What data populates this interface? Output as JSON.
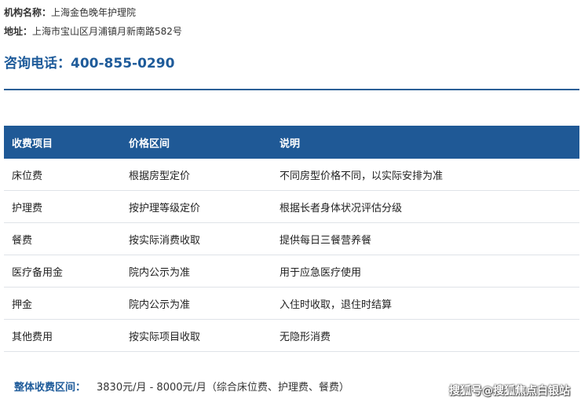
{
  "institution": {
    "name_label": "机构名称：",
    "name": "上海金色晚年护理院",
    "address_label": "地址：",
    "address": "上海市宝山区月浦镇月新南路582号"
  },
  "contact": {
    "phone_label": "咨询电话：",
    "phone": "400-855-0290"
  },
  "fee_table": {
    "headers": [
      "收费项目",
      "价格区间",
      "说明"
    ],
    "rows": [
      [
        "床位费",
        "根据房型定价",
        "不同房型价格不同，以实际安排为准"
      ],
      [
        "护理费",
        "按护理等级定价",
        "根据长者身体状况评估分级"
      ],
      [
        "餐费",
        "按实际消费收取",
        "提供每日三餐营养餐"
      ],
      [
        "医疗备用金",
        "院内公示为准",
        "用于应急医疗使用"
      ],
      [
        "押金",
        "院内公示为准",
        "入住时收取，退住时结算"
      ],
      [
        "其他费用",
        "按实际项目收取",
        "无隐形消费"
      ]
    ]
  },
  "summary": {
    "label": "整体收费区间：",
    "value": "3830元/月 - 8000元/月（综合床位费、护理费、餐费）"
  },
  "watermark": "搜狐号@搜狐焦点白银站",
  "colors": {
    "accent": "#1e5b9a",
    "header_bg": "#1f5996",
    "row_border": "#dfe3e8"
  }
}
